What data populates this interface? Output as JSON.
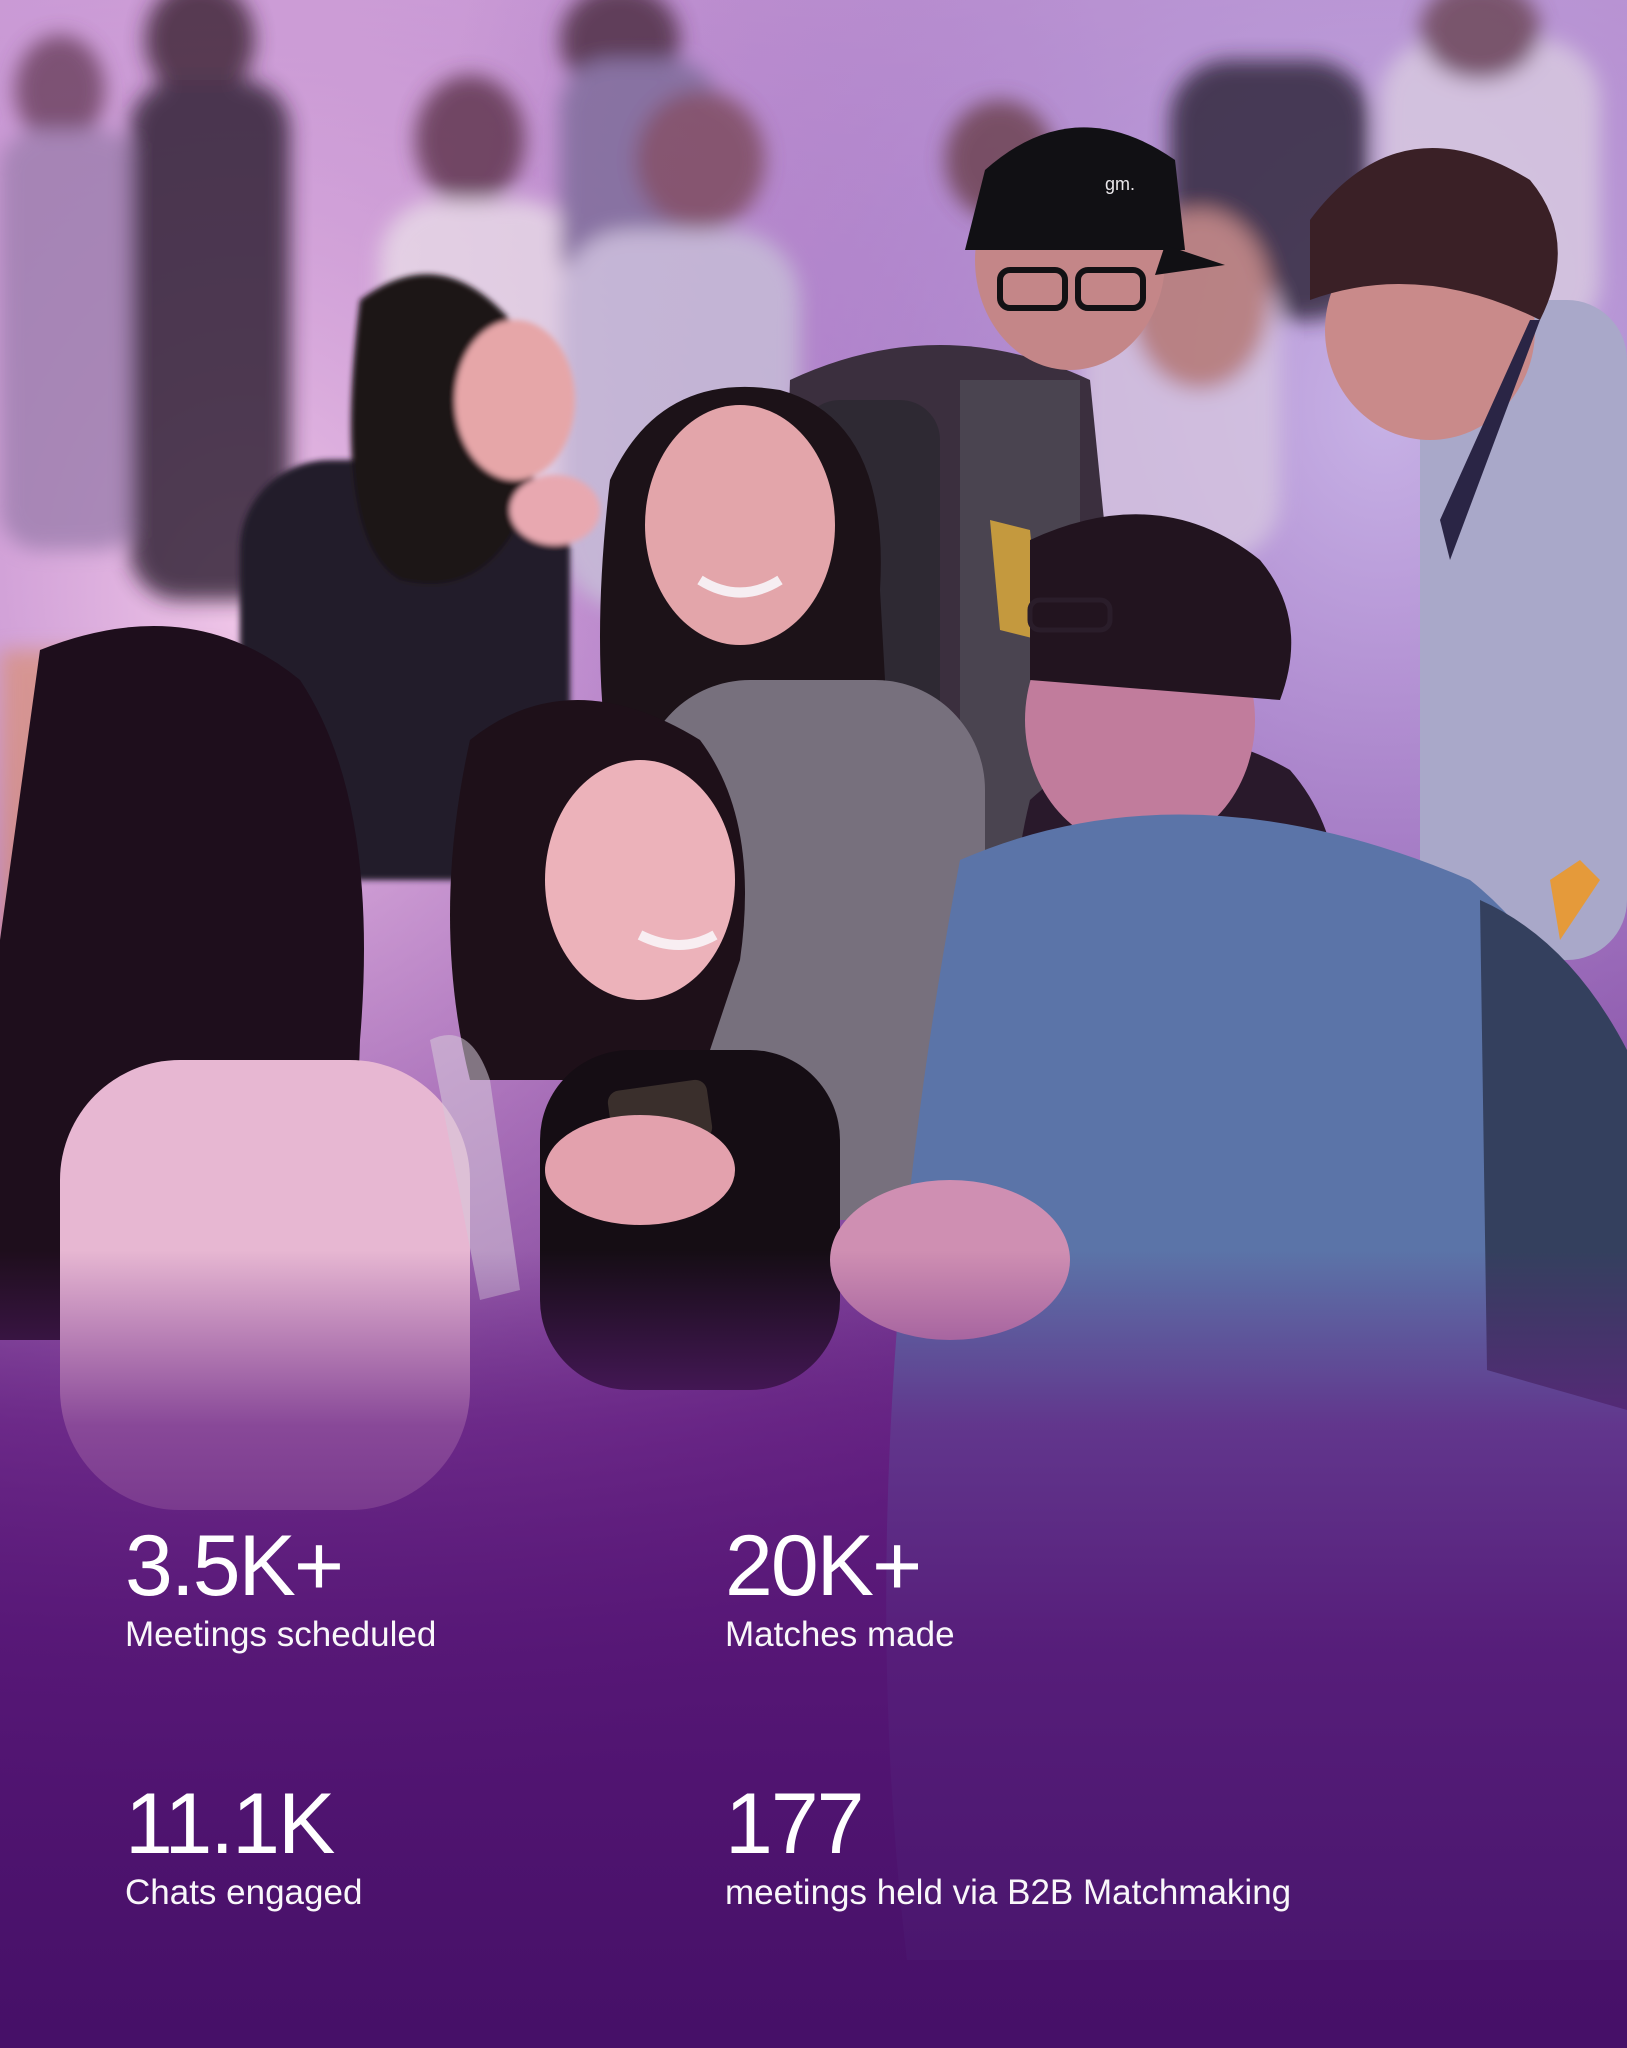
{
  "stats": [
    {
      "value": "3.5K+",
      "label": "Meetings scheduled"
    },
    {
      "value": "20K+",
      "label": "Matches made"
    },
    {
      "value": "11.1K",
      "label": "Chats engaged"
    },
    {
      "value": "177",
      "label": "meetings held via B2B Matchmaking"
    }
  ],
  "colors": {
    "overlay": "#5a1f78",
    "text": "#ffffff"
  }
}
